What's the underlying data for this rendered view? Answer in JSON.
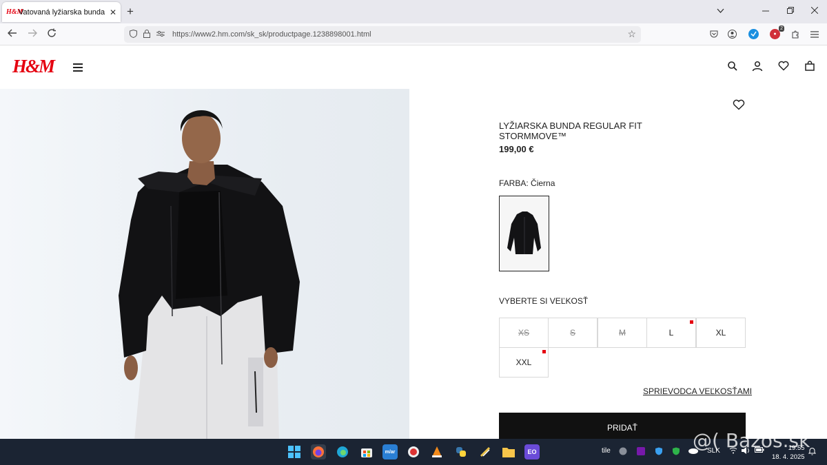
{
  "browser": {
    "tab_title": "Vatovaná lyžiarska bunda Regul",
    "tab_favicon": "H&M",
    "tab_close": "✕",
    "new_tab": "+",
    "url": "https://www2.hm.com/sk_sk/productpage.1238898001.html",
    "extension_badge": "2"
  },
  "site": {
    "logo": "H&M",
    "brand_color": "#e50010"
  },
  "product": {
    "title": "LYŽIARSKA BUNDA REGULAR FIT STORMMOVE™",
    "price": "199,00 €",
    "color_label": "FARBA:",
    "color_value": "Čierna",
    "size_heading": "VYBERTE SI VEĽKOSŤ",
    "sizes": [
      {
        "label": "XS",
        "available": false,
        "low_stock": false
      },
      {
        "label": "S",
        "available": false,
        "low_stock": false
      },
      {
        "label": "M",
        "available": false,
        "low_stock": false
      },
      {
        "label": "L",
        "available": true,
        "low_stock": true
      },
      {
        "label": "XL",
        "available": true,
        "low_stock": false
      },
      {
        "label": "XXL",
        "available": true,
        "low_stock": true
      }
    ],
    "size_guide": "SPRIEVODCA VEĽKOSŤAMI",
    "add_button": "PRIDAŤ"
  },
  "taskbar": {
    "tray_text": "tile",
    "language": "SLK",
    "time": "19:55",
    "date": "18. 4. 2025"
  },
  "watermark": "@( Bazos.sk"
}
